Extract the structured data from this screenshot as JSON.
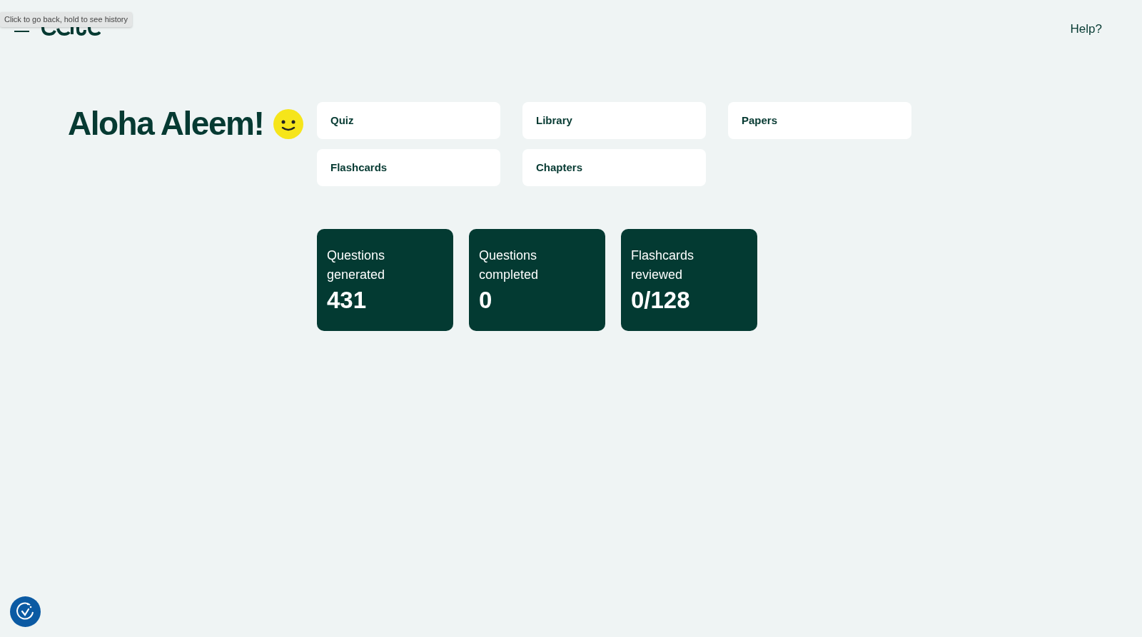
{
  "tooltip": "Click to go back, hold to see history",
  "help": "Help?",
  "greeting": "Aloha Aleem!",
  "nav_buttons": [
    {
      "label": "Quiz"
    },
    {
      "label": "Library"
    },
    {
      "label": "Papers"
    },
    {
      "label": "Flashcards"
    },
    {
      "label": "Chapters"
    }
  ],
  "stats": [
    {
      "label": "Questions generated",
      "value": "431"
    },
    {
      "label": "Questions completed",
      "value": "0"
    },
    {
      "label": "Flashcards reviewed",
      "value": "0/128"
    }
  ]
}
